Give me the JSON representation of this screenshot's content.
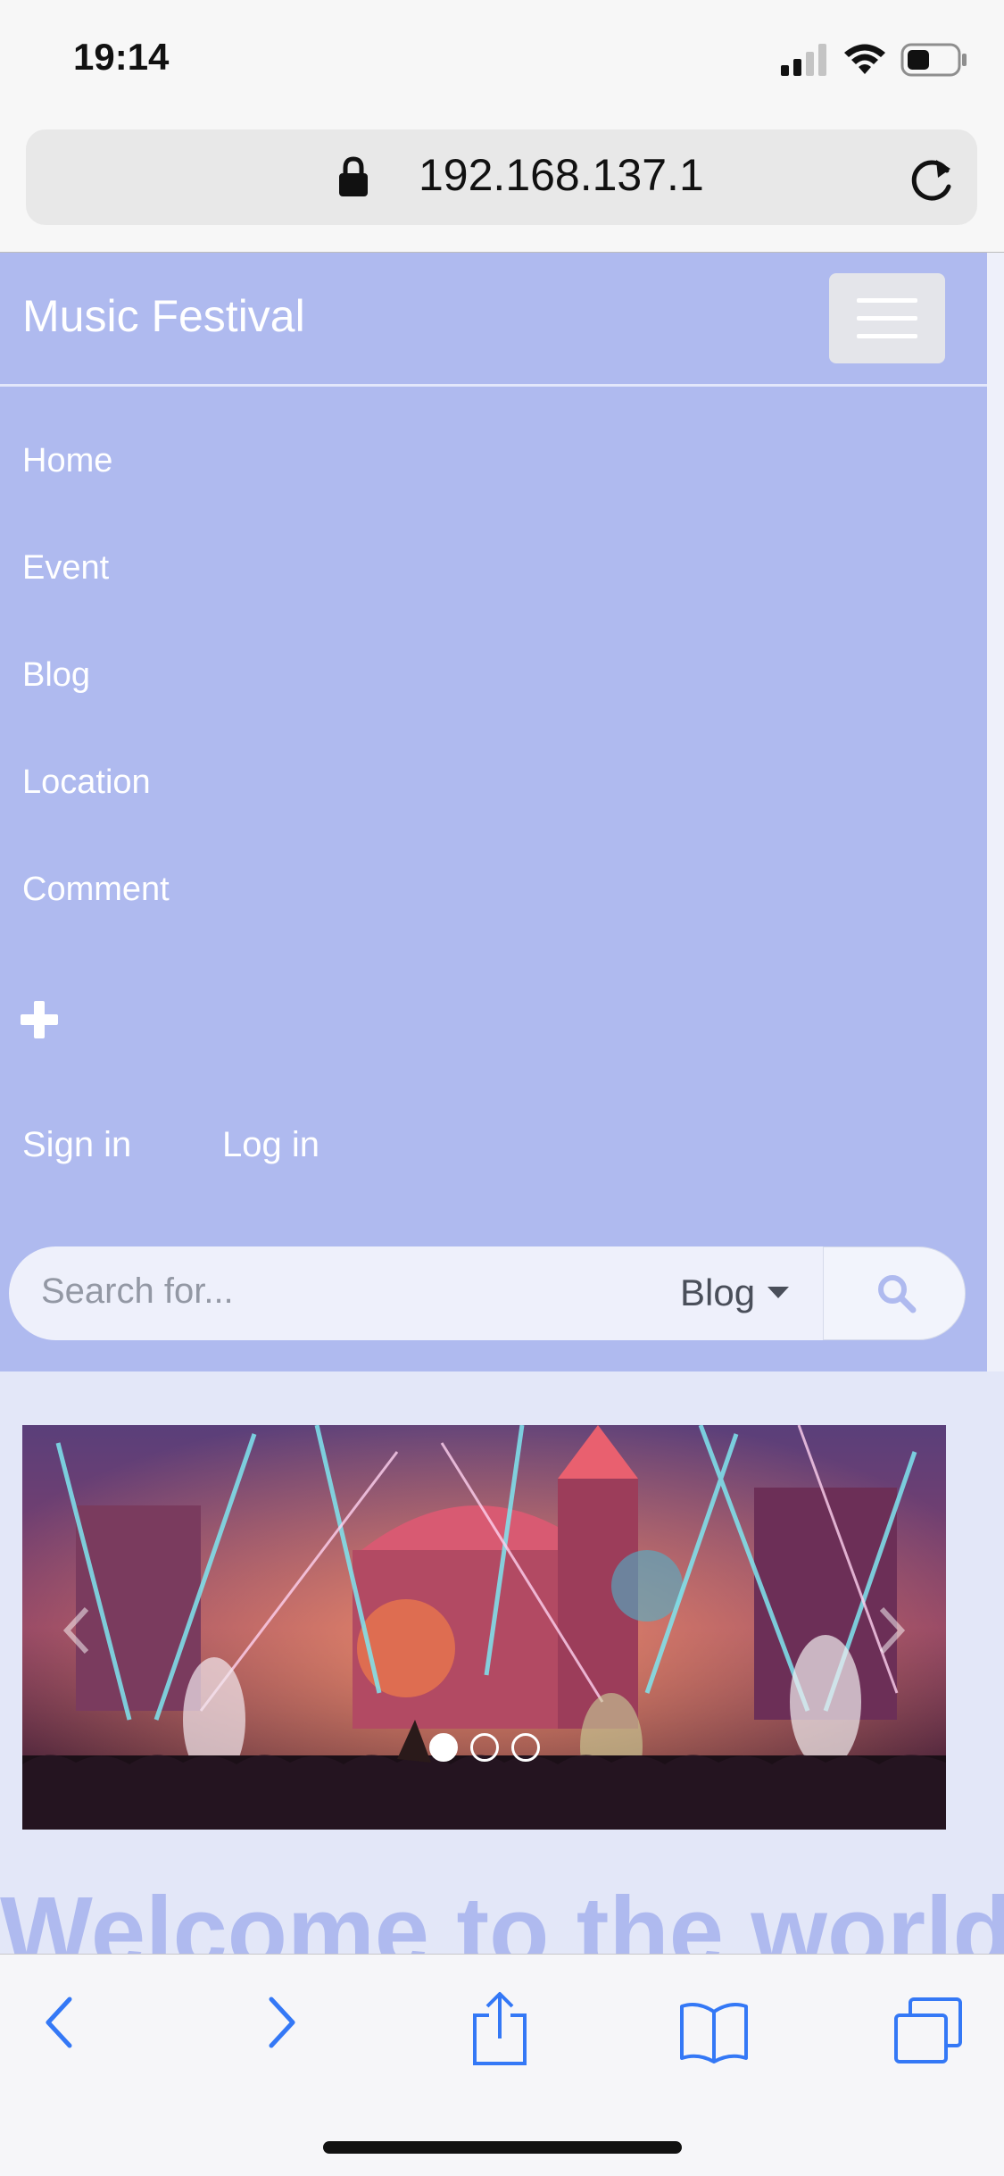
{
  "status_bar": {
    "time": "19:14"
  },
  "browser": {
    "url": "192.168.137.1"
  },
  "navbar": {
    "brand": "Music Festival",
    "items": [
      {
        "label": "Home"
      },
      {
        "label": "Event"
      },
      {
        "label": "Blog"
      },
      {
        "label": "Location"
      },
      {
        "label": "Comment"
      }
    ],
    "sign_in": "Sign in",
    "log_in": "Log in",
    "search": {
      "placeholder": "Search for...",
      "category": "Blog"
    }
  },
  "carousel": {
    "slide_count": 3,
    "active_index": 0
  },
  "main": {
    "welcome": "Welcome to the world"
  },
  "colors": {
    "navbar_bg": "#afbaef",
    "ios_blue": "#3478f6",
    "page_bg": "#eef0fa"
  }
}
